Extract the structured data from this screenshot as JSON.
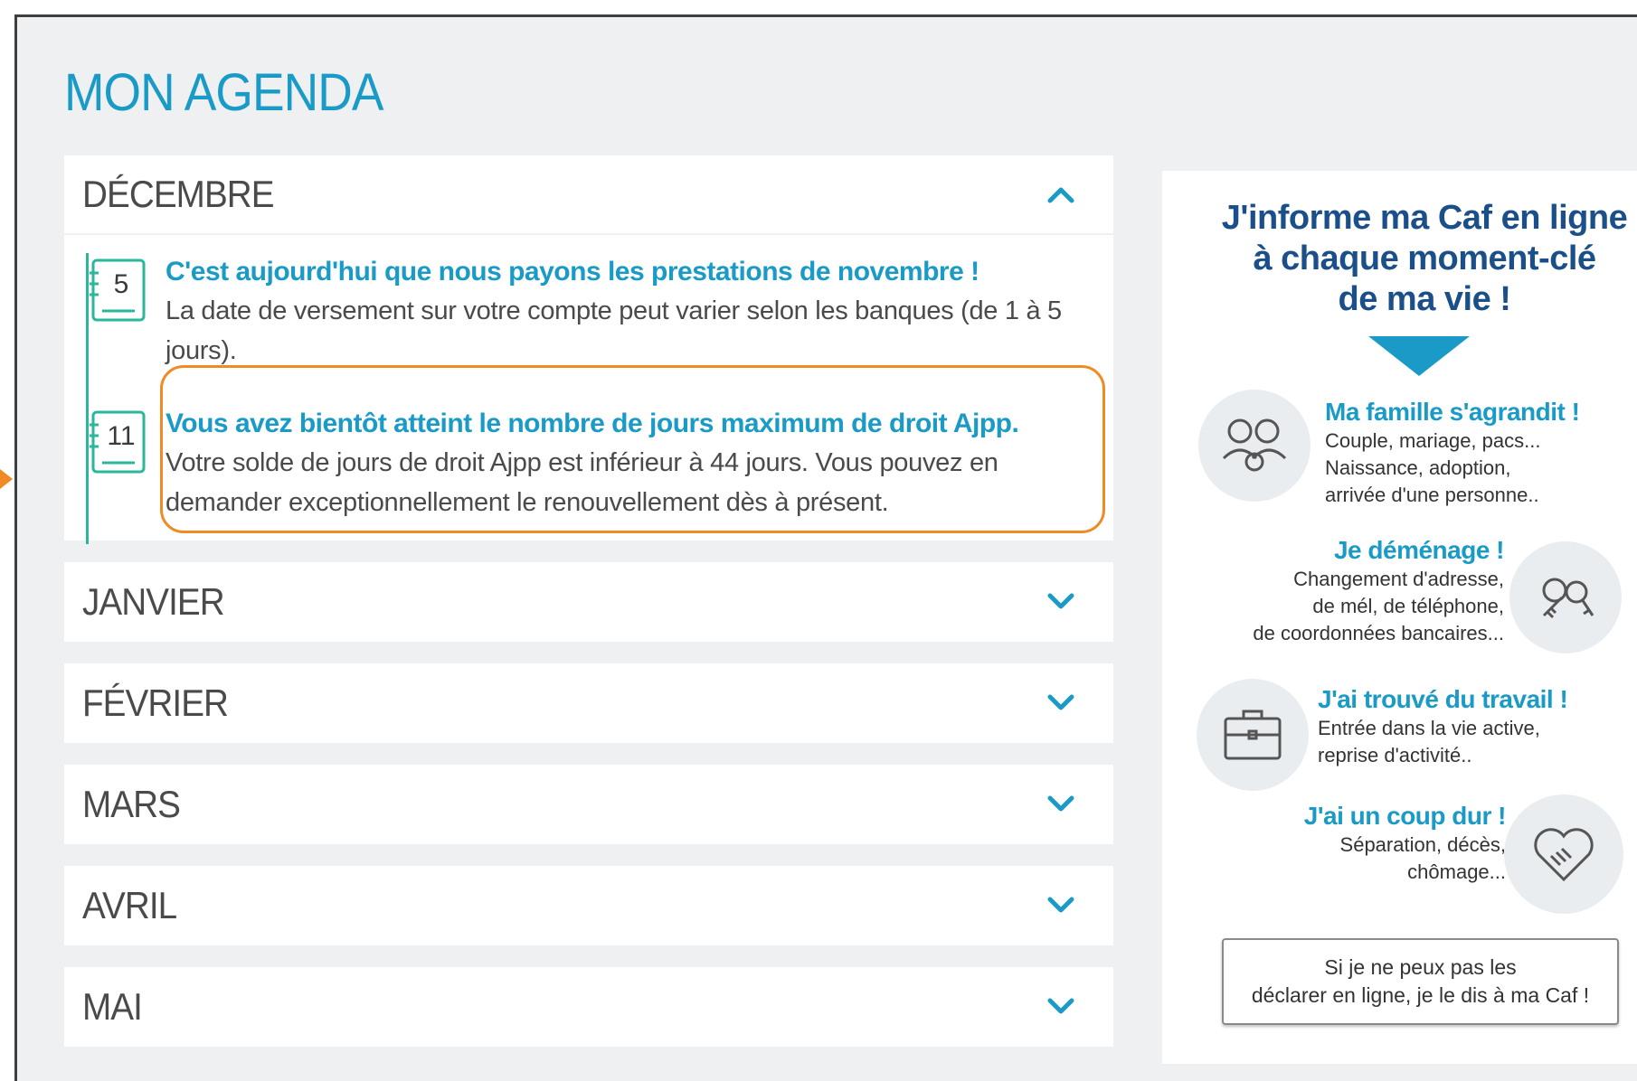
{
  "page": {
    "title": "MON AGENDA"
  },
  "agenda": {
    "months": [
      {
        "name": "DÉCEMBRE",
        "expanded": true
      },
      {
        "name": "JANVIER",
        "expanded": false
      },
      {
        "name": "FÉVRIER",
        "expanded": false
      },
      {
        "name": "MARS",
        "expanded": false
      },
      {
        "name": "AVRIL",
        "expanded": false
      },
      {
        "name": "MAI",
        "expanded": false
      }
    ],
    "events": [
      {
        "day": "5",
        "title": "C'est aujourd'hui que nous payons les prestations de novembre !",
        "text": "La date de versement sur votre compte peut varier selon les banques (de 1 à 5 jours)."
      },
      {
        "day": "11",
        "title": "Vous avez bientôt atteint le nombre de jours maximum de droit Ajpp.",
        "text": "Votre solde de jours de droit Ajpp est inférieur à 44 jours. Vous pouvez en demander exceptionnellement le renouvellement dès à présent."
      }
    ]
  },
  "sidebar": {
    "title_lines": [
      "J'informe ma Caf en ligne",
      "à chaque moment-clé",
      "de ma vie !"
    ],
    "items": [
      {
        "heading": "Ma famille s'agrandit !",
        "lines": [
          "Couple, mariage, pacs...",
          "Naissance, adoption,",
          "arrivée d'une personne.."
        ],
        "icon": "family-icon"
      },
      {
        "heading": "Je déménage !",
        "lines": [
          "Changement d'adresse,",
          "de mél, de téléphone,",
          "de coordonnées bancaires..."
        ],
        "icon": "keys-icon"
      },
      {
        "heading": "J'ai trouvé du travail !",
        "lines": [
          "Entrée dans la vie active,",
          "reprise d'activité.."
        ],
        "icon": "briefcase-icon"
      },
      {
        "heading": "J'ai un coup dur !",
        "lines": [
          "Séparation, décès,",
          "chômage..."
        ],
        "icon": "heart-handshake-icon"
      }
    ],
    "declare_lines": [
      "Si je ne peux pas les",
      "déclarer en ligne, je le dis à ma Caf !"
    ]
  },
  "colors": {
    "accent": "#1a9bc7",
    "title_blue": "#1a4f8a",
    "timeline": "#2bb79a",
    "highlight": "#f08a24",
    "background": "#eef0f2"
  }
}
